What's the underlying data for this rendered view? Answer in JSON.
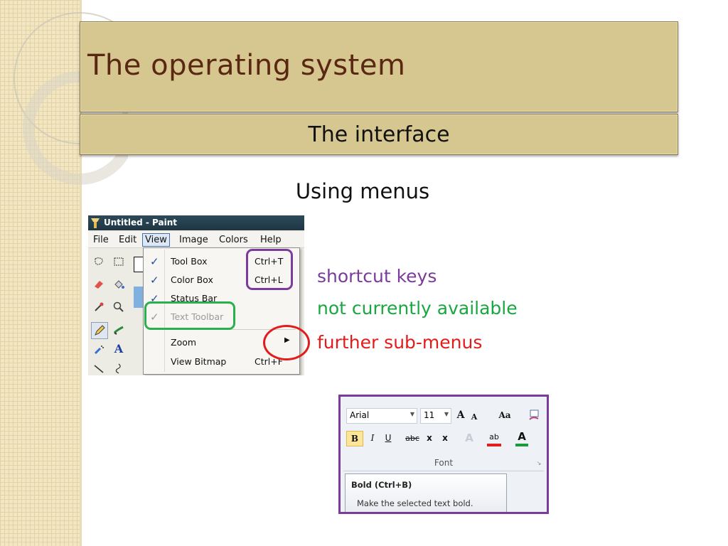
{
  "slide": {
    "title": "The operating system",
    "subtitle": "The interface",
    "heading": "Using menus"
  },
  "paint_window": {
    "title": "Untitled - Paint",
    "menus": [
      "File",
      "Edit",
      "View",
      "Image",
      "Colors",
      "Help"
    ],
    "open_menu": "View",
    "view_menu": {
      "items": [
        {
          "label": "Tool Box",
          "shortcut": "Ctrl+T",
          "checked": true,
          "enabled": true
        },
        {
          "label": "Color Box",
          "shortcut": "Ctrl+L",
          "checked": true,
          "enabled": true
        },
        {
          "label": "Status Bar",
          "shortcut": "",
          "checked": true,
          "enabled": true
        },
        {
          "label": "Text Toolbar",
          "shortcut": "",
          "checked": true,
          "enabled": false
        },
        {
          "label": "Zoom",
          "shortcut": "",
          "checked": false,
          "enabled": true,
          "submenu": true
        },
        {
          "label": "View Bitmap",
          "shortcut": "Ctrl+F",
          "checked": false,
          "enabled": true
        }
      ],
      "check_glyph": "✓",
      "submenu_glyph": "▶"
    }
  },
  "legend": {
    "shortcut": "shortcut keys",
    "unavailable": "not currently available",
    "submenu": "further sub-menus"
  },
  "colors": {
    "shortcut": "#7a3b9c",
    "unavailable": "#2ab04e",
    "submenu": "#e31b1b",
    "title_text": "#5a2812",
    "title_bar": "#d6c690"
  },
  "ribbon": {
    "font_name": "Arial",
    "font_size": "11",
    "buttons": {
      "grow": "A",
      "shrink": "A",
      "change_case": "Aa",
      "bold": "B",
      "italic": "I",
      "underline": "U",
      "strikethrough": "abc",
      "subscript": "x",
      "superscript": "x",
      "text_effects": "A",
      "highlight": "ab",
      "font_color": "A"
    },
    "group_label": "Font",
    "tooltip_title": "Bold (Ctrl+B)",
    "tooltip_desc": "Make the selected text bold."
  }
}
